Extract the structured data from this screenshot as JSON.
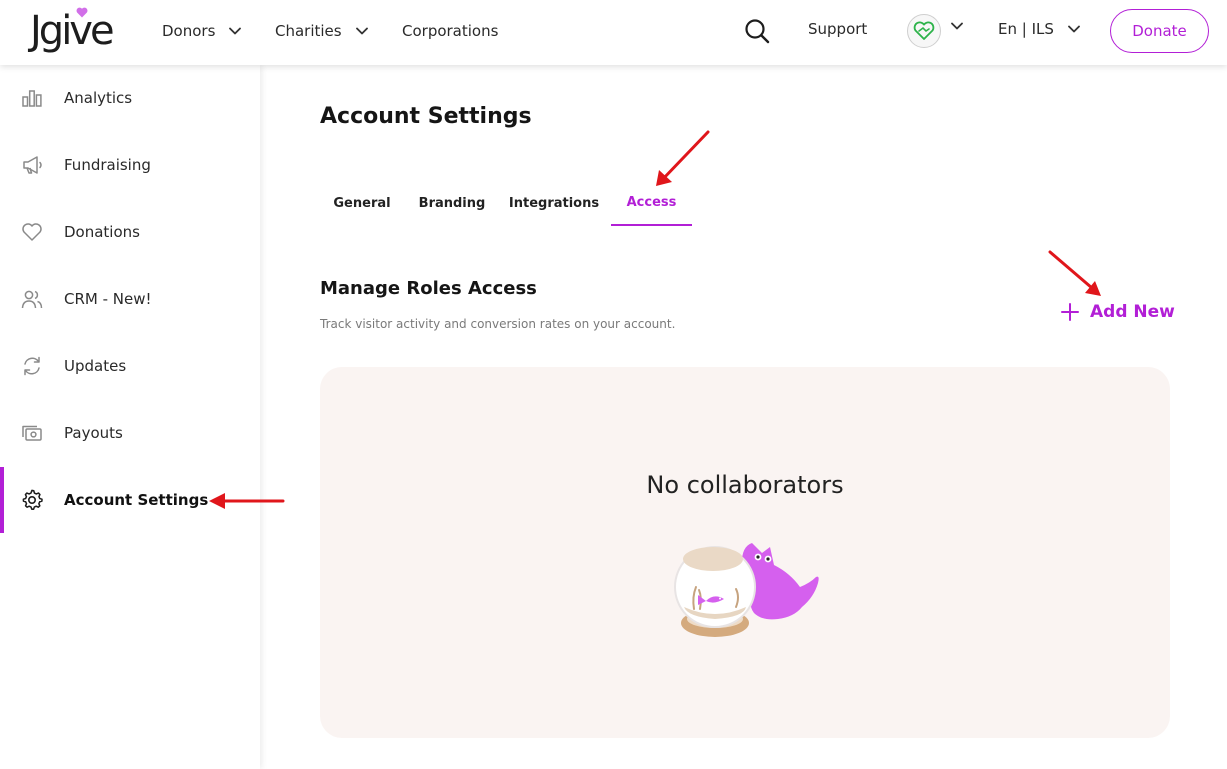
{
  "header": {
    "logo_text": "Jgive",
    "nav": [
      {
        "label": "Donors",
        "has_dropdown": true
      },
      {
        "label": "Charities",
        "has_dropdown": true
      },
      {
        "label": "Corporations",
        "has_dropdown": false
      }
    ],
    "support_label": "Support",
    "language_label": "En | ILS",
    "donate_label": "Donate"
  },
  "sidebar": {
    "items": [
      {
        "label": "Analytics",
        "icon": "bar-chart-icon",
        "active": false
      },
      {
        "label": "Fundraising",
        "icon": "megaphone-icon",
        "active": false
      },
      {
        "label": "Donations",
        "icon": "heart-icon",
        "active": false
      },
      {
        "label": "CRM - New!",
        "icon": "users-icon",
        "active": false
      },
      {
        "label": "Updates",
        "icon": "refresh-icon",
        "active": false
      },
      {
        "label": "Payouts",
        "icon": "cash-icon",
        "active": false
      },
      {
        "label": "Account Settings",
        "icon": "gear-icon",
        "active": true
      }
    ]
  },
  "main": {
    "title": "Account Settings",
    "tabs": [
      {
        "label": "General",
        "active": false
      },
      {
        "label": "Branding",
        "active": false
      },
      {
        "label": "Integrations",
        "active": false
      },
      {
        "label": "Access",
        "active": true
      }
    ],
    "section": {
      "title": "Manage Roles Access",
      "subtitle": "Track visitor activity and conversion rates on your account.",
      "add_label": "Add New"
    },
    "empty_state": {
      "title": "No collaborators"
    }
  },
  "colors": {
    "accent": "#b21fd6",
    "card_bg": "#faf4f2",
    "annotation_arrow": "#e0161b"
  }
}
